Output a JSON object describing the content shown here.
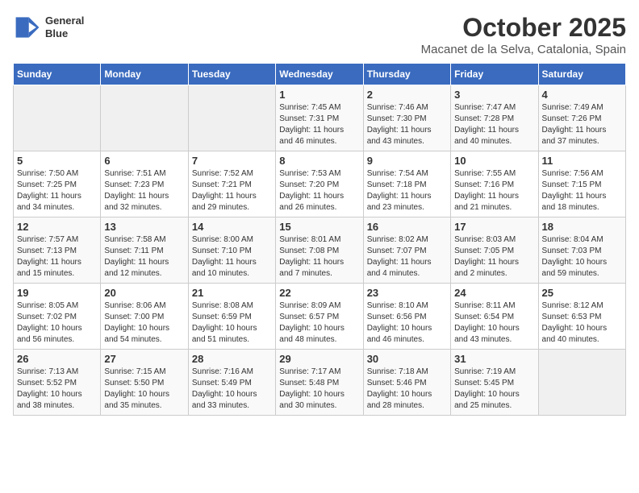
{
  "header": {
    "logo_line1": "General",
    "logo_line2": "Blue",
    "month": "October 2025",
    "location": "Macanet de la Selva, Catalonia, Spain"
  },
  "weekdays": [
    "Sunday",
    "Monday",
    "Tuesday",
    "Wednesday",
    "Thursday",
    "Friday",
    "Saturday"
  ],
  "weeks": [
    [
      {
        "day": "",
        "info": ""
      },
      {
        "day": "",
        "info": ""
      },
      {
        "day": "",
        "info": ""
      },
      {
        "day": "1",
        "info": "Sunrise: 7:45 AM\nSunset: 7:31 PM\nDaylight: 11 hours\nand 46 minutes."
      },
      {
        "day": "2",
        "info": "Sunrise: 7:46 AM\nSunset: 7:30 PM\nDaylight: 11 hours\nand 43 minutes."
      },
      {
        "day": "3",
        "info": "Sunrise: 7:47 AM\nSunset: 7:28 PM\nDaylight: 11 hours\nand 40 minutes."
      },
      {
        "day": "4",
        "info": "Sunrise: 7:49 AM\nSunset: 7:26 PM\nDaylight: 11 hours\nand 37 minutes."
      }
    ],
    [
      {
        "day": "5",
        "info": "Sunrise: 7:50 AM\nSunset: 7:25 PM\nDaylight: 11 hours\nand 34 minutes."
      },
      {
        "day": "6",
        "info": "Sunrise: 7:51 AM\nSunset: 7:23 PM\nDaylight: 11 hours\nand 32 minutes."
      },
      {
        "day": "7",
        "info": "Sunrise: 7:52 AM\nSunset: 7:21 PM\nDaylight: 11 hours\nand 29 minutes."
      },
      {
        "day": "8",
        "info": "Sunrise: 7:53 AM\nSunset: 7:20 PM\nDaylight: 11 hours\nand 26 minutes."
      },
      {
        "day": "9",
        "info": "Sunrise: 7:54 AM\nSunset: 7:18 PM\nDaylight: 11 hours\nand 23 minutes."
      },
      {
        "day": "10",
        "info": "Sunrise: 7:55 AM\nSunset: 7:16 PM\nDaylight: 11 hours\nand 21 minutes."
      },
      {
        "day": "11",
        "info": "Sunrise: 7:56 AM\nSunset: 7:15 PM\nDaylight: 11 hours\nand 18 minutes."
      }
    ],
    [
      {
        "day": "12",
        "info": "Sunrise: 7:57 AM\nSunset: 7:13 PM\nDaylight: 11 hours\nand 15 minutes."
      },
      {
        "day": "13",
        "info": "Sunrise: 7:58 AM\nSunset: 7:11 PM\nDaylight: 11 hours\nand 12 minutes."
      },
      {
        "day": "14",
        "info": "Sunrise: 8:00 AM\nSunset: 7:10 PM\nDaylight: 11 hours\nand 10 minutes."
      },
      {
        "day": "15",
        "info": "Sunrise: 8:01 AM\nSunset: 7:08 PM\nDaylight: 11 hours\nand 7 minutes."
      },
      {
        "day": "16",
        "info": "Sunrise: 8:02 AM\nSunset: 7:07 PM\nDaylight: 11 hours\nand 4 minutes."
      },
      {
        "day": "17",
        "info": "Sunrise: 8:03 AM\nSunset: 7:05 PM\nDaylight: 11 hours\nand 2 minutes."
      },
      {
        "day": "18",
        "info": "Sunrise: 8:04 AM\nSunset: 7:03 PM\nDaylight: 10 hours\nand 59 minutes."
      }
    ],
    [
      {
        "day": "19",
        "info": "Sunrise: 8:05 AM\nSunset: 7:02 PM\nDaylight: 10 hours\nand 56 minutes."
      },
      {
        "day": "20",
        "info": "Sunrise: 8:06 AM\nSunset: 7:00 PM\nDaylight: 10 hours\nand 54 minutes."
      },
      {
        "day": "21",
        "info": "Sunrise: 8:08 AM\nSunset: 6:59 PM\nDaylight: 10 hours\nand 51 minutes."
      },
      {
        "day": "22",
        "info": "Sunrise: 8:09 AM\nSunset: 6:57 PM\nDaylight: 10 hours\nand 48 minutes."
      },
      {
        "day": "23",
        "info": "Sunrise: 8:10 AM\nSunset: 6:56 PM\nDaylight: 10 hours\nand 46 minutes."
      },
      {
        "day": "24",
        "info": "Sunrise: 8:11 AM\nSunset: 6:54 PM\nDaylight: 10 hours\nand 43 minutes."
      },
      {
        "day": "25",
        "info": "Sunrise: 8:12 AM\nSunset: 6:53 PM\nDaylight: 10 hours\nand 40 minutes."
      }
    ],
    [
      {
        "day": "26",
        "info": "Sunrise: 7:13 AM\nSunset: 5:52 PM\nDaylight: 10 hours\nand 38 minutes."
      },
      {
        "day": "27",
        "info": "Sunrise: 7:15 AM\nSunset: 5:50 PM\nDaylight: 10 hours\nand 35 minutes."
      },
      {
        "day": "28",
        "info": "Sunrise: 7:16 AM\nSunset: 5:49 PM\nDaylight: 10 hours\nand 33 minutes."
      },
      {
        "day": "29",
        "info": "Sunrise: 7:17 AM\nSunset: 5:48 PM\nDaylight: 10 hours\nand 30 minutes."
      },
      {
        "day": "30",
        "info": "Sunrise: 7:18 AM\nSunset: 5:46 PM\nDaylight: 10 hours\nand 28 minutes."
      },
      {
        "day": "31",
        "info": "Sunrise: 7:19 AM\nSunset: 5:45 PM\nDaylight: 10 hours\nand 25 minutes."
      },
      {
        "day": "",
        "info": ""
      }
    ]
  ]
}
